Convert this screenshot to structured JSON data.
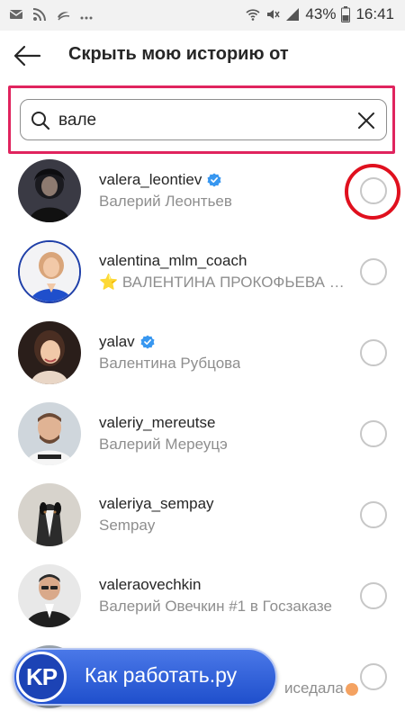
{
  "status_bar": {
    "battery": "43%",
    "time": "16:41",
    "left_icons": [
      "mail-icon",
      "rss-icon",
      "bank-icon",
      "more-dots-icon"
    ],
    "right_icons": [
      "wifi-icon",
      "mute-icon",
      "signal-icon",
      "battery-icon"
    ]
  },
  "header": {
    "title": "Скрыть мою историю от",
    "back_icon": "arrow-left-icon"
  },
  "search": {
    "value": "вале",
    "clear_icon": "close-icon"
  },
  "colors": {
    "highlight": "#e0245e",
    "radio_highlight": "#e0101e",
    "verified": "#3897f0",
    "secondary_text": "#8e8e8e"
  },
  "users": [
    {
      "username": "valera_leontiev",
      "fullname": "Валерий Леонтьев",
      "verified": true
    },
    {
      "username": "valentina_mlm_coach",
      "fullname": "⭐ ВАЛЕНТИНА ПРОКОФЬЕВА О ...",
      "verified": false
    },
    {
      "username": "yalav",
      "fullname": "Валентина Рубцова",
      "verified": true
    },
    {
      "username": "valeriy_mereutse",
      "fullname": "Валерий Мереуцэ",
      "verified": false
    },
    {
      "username": "valeriya_sempay",
      "fullname": "Sempay",
      "verified": false
    },
    {
      "username": "valeraovechkin",
      "fullname": "Валерий Овечкин #1 в Госзаказе",
      "verified": false
    }
  ],
  "partial_row": {
    "fullname_tail": "иседала"
  },
  "watermark": {
    "badge": "KP",
    "text": "Как работать.ру"
  }
}
